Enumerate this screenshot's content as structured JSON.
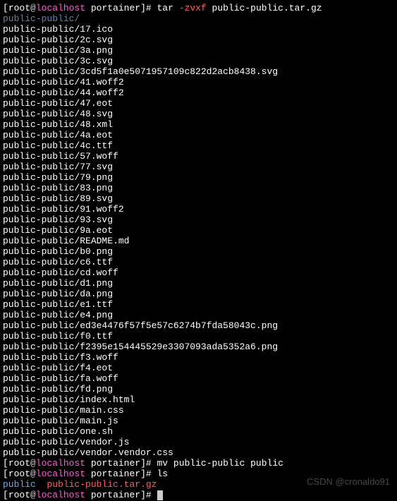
{
  "prompt": {
    "open": "[",
    "user": "root",
    "at": "@",
    "host": "localhost",
    "space": " ",
    "dir": "portainer",
    "close": "]# "
  },
  "cmd1": {
    "base": "tar ",
    "flag": "-zvxf",
    "rest": " public-public.tar.gz"
  },
  "tar_output": [
    "public-public/",
    "public-public/17.ico",
    "public-public/2c.svg",
    "public-public/3a.png",
    "public-public/3c.svg",
    "public-public/3cd5f1a0e5071957109c822d2acb8438.svg",
    "public-public/41.woff2",
    "public-public/44.woff2",
    "public-public/47.eot",
    "public-public/48.svg",
    "public-public/48.xml",
    "public-public/4a.eot",
    "public-public/4c.ttf",
    "public-public/57.woff",
    "public-public/77.svg",
    "public-public/79.png",
    "public-public/83.png",
    "public-public/89.svg",
    "public-public/91.woff2",
    "public-public/93.svg",
    "public-public/9a.eot",
    "public-public/README.md",
    "public-public/b0.png",
    "public-public/c6.ttf",
    "public-public/cd.woff",
    "public-public/d1.png",
    "public-public/da.png",
    "public-public/e1.ttf",
    "public-public/e4.png",
    "public-public/ed3e4476f57f5e57c6274b7fda58043c.png",
    "public-public/f0.ttf",
    "public-public/f2395e154445529e3307093ada5352a6.png",
    "public-public/f3.woff",
    "public-public/f4.eot",
    "public-public/fa.woff",
    "public-public/fd.png",
    "public-public/index.html",
    "public-public/main.css",
    "public-public/main.js",
    "public-public/one.sh",
    "public-public/vendor.js",
    "public-public/vendor.vendor.css"
  ],
  "cmd2": "mv public-public public",
  "cmd3": "ls",
  "ls_output": {
    "dir": "public",
    "spacer": "  ",
    "archive": "public-public.tar.gz"
  },
  "watermark": "CSDN @cronaldo91"
}
